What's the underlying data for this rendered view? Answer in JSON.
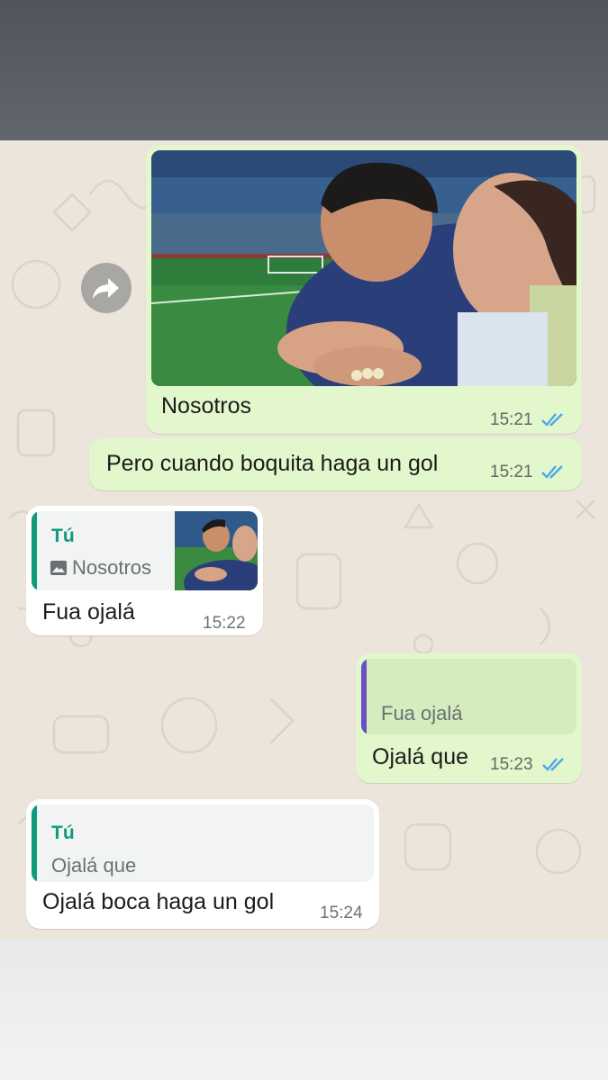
{
  "messages": {
    "m1": {
      "caption": "Nosotros",
      "time": "15:21"
    },
    "m2": {
      "text": "Pero cuando boquita haga un gol",
      "time": "15:21"
    },
    "m3": {
      "quote_author": "Tú",
      "quote_text": "Nosotros",
      "text": "Fua ojalá",
      "time": "15:22"
    },
    "m4": {
      "quote_text": "Fua ojalá",
      "text": "Ojalá que",
      "time": "15:23"
    },
    "m5": {
      "quote_author": "Tú",
      "quote_text": "Ojalá que",
      "text": "Ojalá boca haga un gol",
      "time": "15:24"
    }
  },
  "icons": {
    "forward": "forward-arrow-icon",
    "read_receipt": "double-check-icon",
    "image": "image-icon"
  },
  "colors": {
    "outgoing_bubble": "#e2f7cb",
    "incoming_bubble": "#ffffff",
    "chat_background": "#ece5dc",
    "quote_bar_incoming": "#0f9a7c",
    "quote_bar_outgoing": "#6b4fc4",
    "ticks_read": "#4fa8e8"
  }
}
